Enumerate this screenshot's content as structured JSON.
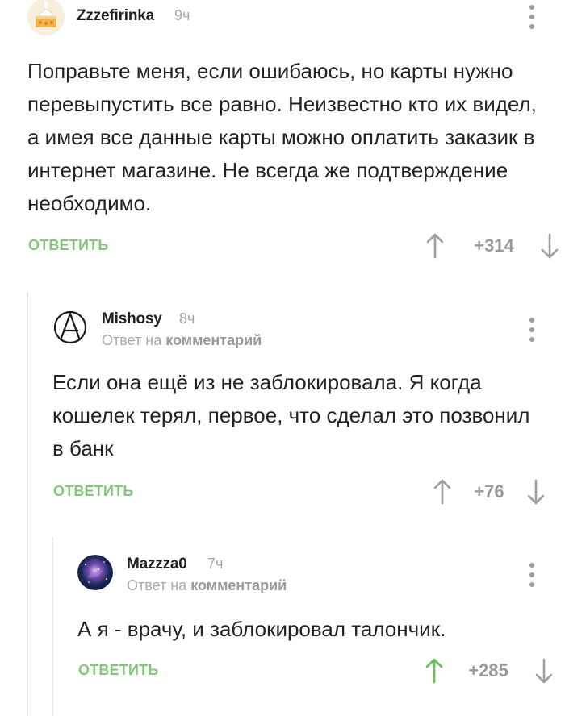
{
  "comments": [
    {
      "author": "Zzzefirinka",
      "time": "9ч",
      "text": "Поправьте меня, если ошибаюсь, но карты нужно перевыпустить все равно. Неизвестно кто их видел, а имея все данные карты можно оплатить заказик в интернет магазине. Не всегда же подтверждение необходимо.",
      "reply_label": "ОТВЕТИТЬ",
      "rating": "+314",
      "avatar_icon": "cake-icon"
    },
    {
      "author": "Mishosy",
      "time": "8ч",
      "reply_prefix": "Ответ на",
      "reply_link": "комментарий",
      "text": "Если она ещё из не заблокировала. Я когда кошелек терял, первое, что сделал это позвонил в банк",
      "reply_label": "ОТВЕТИТЬ",
      "rating": "+76",
      "avatar_icon": "anarchy-symbol-icon"
    },
    {
      "author": "Mazzza0",
      "time": "7ч",
      "reply_prefix": "Ответ на",
      "reply_link": "комментарий",
      "text": "А я - врачу, и заблокировал талончик.",
      "reply_label": "ОТВЕТИТЬ",
      "rating": "+285",
      "upvoted": true,
      "avatar_icon": "galaxy-icon"
    }
  ],
  "colors": {
    "accent_green": "#84c77a",
    "upvote_active": "#6bbf5d",
    "muted_gray": "#9a9a9a",
    "thread_line": "#dfe5ea"
  }
}
